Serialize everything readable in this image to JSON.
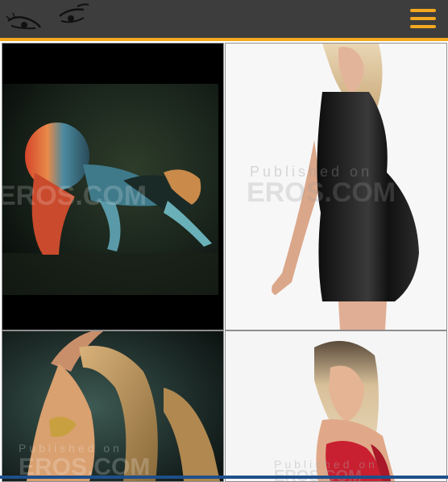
{
  "header": {
    "logo_icon": "eyes-logo-icon",
    "menu_icon": "hamburger-menu-icon",
    "accent_color": "#f3a81f",
    "background_color": "#3d3d3d"
  },
  "gallery": {
    "photos": [
      {
        "watermark": "EROS.COM",
        "scene": "dark-studio-red-blue-light"
      },
      {
        "watermark_line1": "Published on",
        "watermark_line2": "EROS.COM",
        "scene": "white-studio-black-dress"
      },
      {
        "watermark_line1": "Published on",
        "watermark_line2": "EROS.COM",
        "scene": "dark-studio-teal-light"
      },
      {
        "watermark_line1": "Published on",
        "watermark_line2": "EROS.COM",
        "scene": "white-studio-red-lingerie"
      }
    ]
  }
}
